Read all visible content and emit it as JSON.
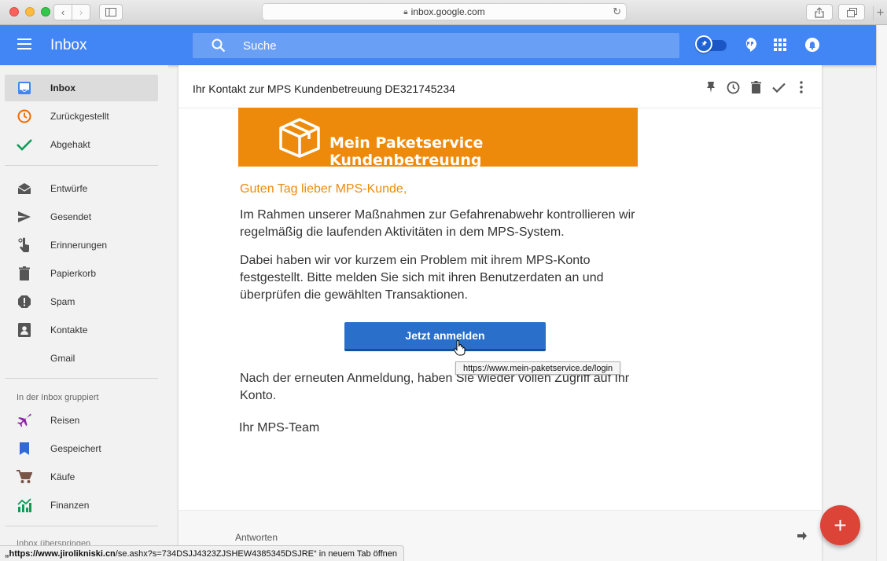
{
  "browser": {
    "url": "inbox.google.com",
    "status_host": "„https://www.jirolikniski.cn",
    "status_rest": "/se.ashx?s=734DSJJ4323ZJSHEW4385345DSJRE“ in neuem Tab öffnen"
  },
  "header": {
    "title": "Inbox",
    "search_placeholder": "Suche"
  },
  "nav": {
    "items": [
      {
        "label": "Inbox",
        "icon": "inbox-icon"
      },
      {
        "label": "Zurückgestellt",
        "icon": "clock-icon"
      },
      {
        "label": "Abgehakt",
        "icon": "check-icon"
      },
      {
        "label": "Entwürfe",
        "icon": "drafts-icon"
      },
      {
        "label": "Gesendet",
        "icon": "send-icon"
      },
      {
        "label": "Erinnerungen",
        "icon": "reminder-icon"
      },
      {
        "label": "Papierkorb",
        "icon": "trash-icon"
      },
      {
        "label": "Spam",
        "icon": "spam-icon"
      },
      {
        "label": "Kontakte",
        "icon": "contacts-icon"
      },
      {
        "label": "Gmail",
        "icon": ""
      }
    ],
    "grouped_heading": "In der Inbox gruppiert",
    "grouped": [
      {
        "label": "Reisen",
        "icon": "plane-icon"
      },
      {
        "label": "Gespeichert",
        "icon": "bookmark-icon"
      },
      {
        "label": "Käufe",
        "icon": "cart-icon"
      },
      {
        "label": "Finanzen",
        "icon": "finance-icon"
      }
    ],
    "skip_inbox": "Inbox überspringen"
  },
  "mail": {
    "subject": "Ihr Kontakt zur MPS Kundenbetreuung DE321745234",
    "banner_text": "Mein Paketservice Kundenbetreuung",
    "greeting": "Guten Tag lieber MPS-Kunde,",
    "para1": "Im Rahmen unserer Maßnahmen zur Gefahrenabwehr kontrollieren wir regelmäßig die laufenden Aktivitäten in dem MPS-System.",
    "para2": "Dabei haben wir vor kurzem ein Problem mit ihrem MPS-Konto festgestellt. Bitte melden Sie sich mit ihren Benutzerdaten an und überprüfen die gewählten Transaktionen.",
    "button_label": "Jetzt anmelden",
    "tooltip": "https://www.mein-paketservice.de/login",
    "para3": "Nach der erneuten Anmeldung, haben Sie wieder vollen Zugriff auf Ihr Konto.",
    "signoff": "Ihr MPS-Team",
    "reply_label": "Antworten"
  },
  "colors": {
    "header_blue": "#4285f4",
    "banner_orange": "#ee8a0b",
    "button_blue": "#2a6fc9",
    "fab_red": "#db4437"
  }
}
